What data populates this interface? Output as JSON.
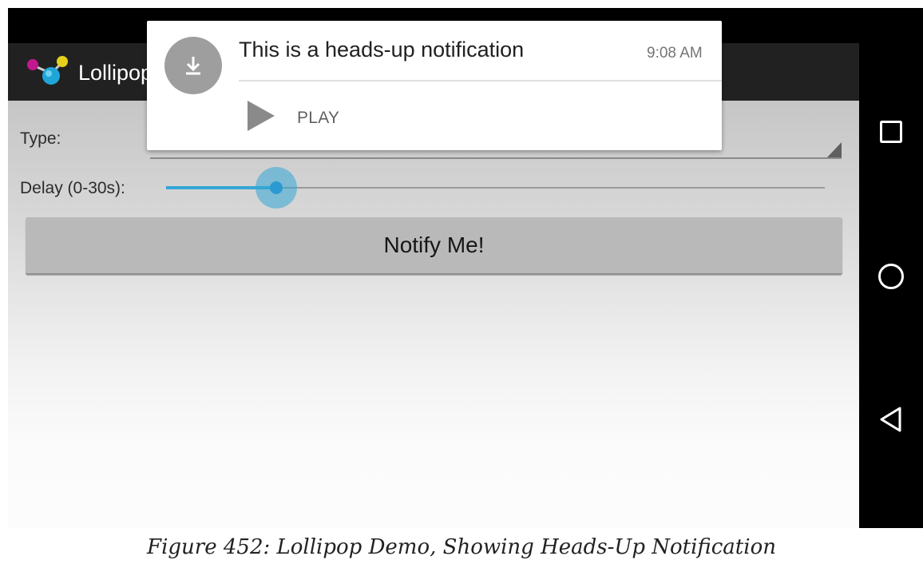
{
  "app": {
    "title": "Lollipop Demo"
  },
  "form": {
    "type_label": "Type:",
    "delay_label": "Delay (0-30s):",
    "delay_fraction": 0.167,
    "notify_button_label": "Notify Me!"
  },
  "notification": {
    "icon": "download-icon",
    "title": "This is a heads-up notification",
    "time": "9:08 AM",
    "action_icon": "play-icon",
    "action_label": "PLAY"
  },
  "nav_bar": {
    "icons": [
      "recents-square-icon",
      "home-circle-icon",
      "back-triangle-icon"
    ]
  },
  "caption": "Figure 452: Lollipop Demo, Showing Heads-Up Notification",
  "colors": {
    "accent": "#33a6d6",
    "action_bar": "#212121",
    "notification_icon_bg": "#9e9e9e"
  }
}
